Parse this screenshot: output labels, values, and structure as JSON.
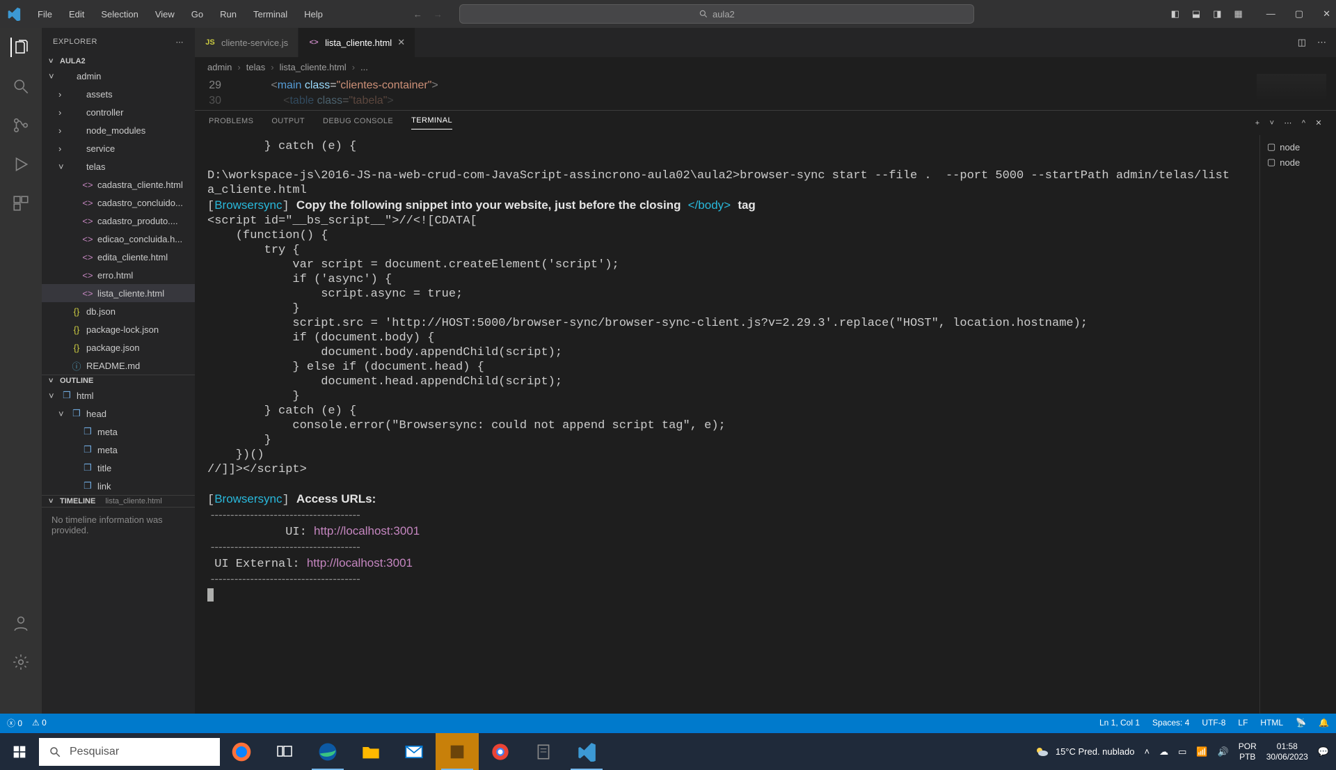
{
  "title_search": "aula2",
  "menu": [
    "File",
    "Edit",
    "Selection",
    "View",
    "Go",
    "Run",
    "Terminal",
    "Help"
  ],
  "sidebar": {
    "title": "EXPLORER",
    "project": "AULA2",
    "tree": [
      {
        "label": "admin",
        "indent": 0,
        "chev": "˅",
        "icon": ""
      },
      {
        "label": "assets",
        "indent": 1,
        "chev": "›",
        "icon": ""
      },
      {
        "label": "controller",
        "indent": 1,
        "chev": "›",
        "icon": ""
      },
      {
        "label": "node_modules",
        "indent": 1,
        "chev": "›",
        "icon": ""
      },
      {
        "label": "service",
        "indent": 1,
        "chev": "›",
        "icon": ""
      },
      {
        "label": "telas",
        "indent": 1,
        "chev": "˅",
        "icon": ""
      },
      {
        "label": "cadastra_cliente.html",
        "indent": 2,
        "chev": "",
        "icon": "<>"
      },
      {
        "label": "cadastro_concluido...",
        "indent": 2,
        "chev": "",
        "icon": "<>"
      },
      {
        "label": "cadastro_produto....",
        "indent": 2,
        "chev": "",
        "icon": "<>"
      },
      {
        "label": "edicao_concluida.h...",
        "indent": 2,
        "chev": "",
        "icon": "<>"
      },
      {
        "label": "edita_cliente.html",
        "indent": 2,
        "chev": "",
        "icon": "<>"
      },
      {
        "label": "erro.html",
        "indent": 2,
        "chev": "",
        "icon": "<>"
      },
      {
        "label": "lista_cliente.html",
        "indent": 2,
        "chev": "",
        "icon": "<>",
        "selected": true
      },
      {
        "label": "db.json",
        "indent": 1,
        "chev": "",
        "icon": "{}",
        "cls": "json"
      },
      {
        "label": "package-lock.json",
        "indent": 1,
        "chev": "",
        "icon": "{}",
        "cls": "json"
      },
      {
        "label": "package.json",
        "indent": 1,
        "chev": "",
        "icon": "{}",
        "cls": "json"
      },
      {
        "label": "README.md",
        "indent": 1,
        "chev": "",
        "icon": "ⓘ",
        "cls": "md"
      }
    ],
    "outline_title": "OUTLINE",
    "outline": [
      {
        "label": "html",
        "indent": 0,
        "chev": "˅",
        "icon": "❒"
      },
      {
        "label": "head",
        "indent": 1,
        "chev": "˅",
        "icon": "❒"
      },
      {
        "label": "meta",
        "indent": 2,
        "chev": "",
        "icon": "❒"
      },
      {
        "label": "meta",
        "indent": 2,
        "chev": "",
        "icon": "❒"
      },
      {
        "label": "title",
        "indent": 2,
        "chev": "",
        "icon": "❒"
      },
      {
        "label": "link",
        "indent": 2,
        "chev": "",
        "icon": "❒"
      }
    ],
    "timeline_title": "TIMELINE",
    "timeline_file": "lista_cliente.html",
    "timeline_empty": "No timeline information was provided."
  },
  "tabs": [
    {
      "icon": "JS",
      "label": "cliente-service.js",
      "active": false
    },
    {
      "icon": "<>",
      "label": "lista_cliente.html",
      "active": true,
      "close": true
    }
  ],
  "breadcrumb": [
    "admin",
    "telas",
    "lista_cliente.html",
    "..."
  ],
  "code": {
    "ln29": "29",
    "ln30": "30",
    "l29": "            <main class=\"clientes-container\">",
    "l30": "                <table class=\"tabela\">"
  },
  "panel": {
    "tabs": [
      "PROBLEMS",
      "OUTPUT",
      "DEBUG CONSOLE",
      "TERMINAL"
    ],
    "active": "TERMINAL",
    "side": [
      "node",
      "node"
    ]
  },
  "terminal": {
    "l1": "        } catch (e) {",
    "prompt": "D:\\workspace-js\\2016-JS-na-web-crud-com-JavaScript-assincrono-aula02\\aula2>browser-sync start --file .  --port 5000 --startPath admin/telas/list",
    "prompt2": "a_cliente.html",
    "bs": "Browsersync",
    "copy_msg": "Copy the following snippet into your website, just before the closing",
    "body_tag": "</body>",
    "tag_word": "tag",
    "script_open": "<script id=\"__bs_script__\">//<![CDATA[",
    "s1": "    (function() {",
    "s2": "        try {",
    "s3": "            var script = document.createElement('script');",
    "s4": "            if ('async') {",
    "s5": "                script.async = true;",
    "s6": "            }",
    "s7": "            script.src = 'http://HOST:5000/browser-sync/browser-sync-client.js?v=2.29.3'.replace(\"HOST\", location.hostname);",
    "s8": "            if (document.body) {",
    "s9": "                document.body.appendChild(script);",
    "s10": "            } else if (document.head) {",
    "s11": "                document.head.appendChild(script);",
    "s12": "            }",
    "s13": "        } catch (e) {",
    "s14": "            console.error(\"Browsersync: could not append script tag\", e);",
    "s15": "        }",
    "s16": "    })()",
    "s17": "//]]></script>",
    "access": "Access URLs:",
    "dash": " --------------------------------------",
    "ui_lbl": "           UI: ",
    "ui_url": "http://localhost:3001",
    "dash2": " --------------------------------------",
    "ext_lbl": " UI External: ",
    "ext_url": "http://localhost:3001",
    "dash3": " --------------------------------------"
  },
  "status": {
    "errors": "0",
    "warnings": "0",
    "pos": "Ln 1, Col 1",
    "spaces": "Spaces: 4",
    "enc": "UTF-8",
    "eol": "LF",
    "lang": "HTML"
  },
  "taskbar": {
    "search_placeholder": "Pesquisar",
    "weather": "15°C  Pred. nublado",
    "lang1": "POR",
    "lang2": "PTB",
    "time": "01:58",
    "date": "30/06/2023"
  }
}
